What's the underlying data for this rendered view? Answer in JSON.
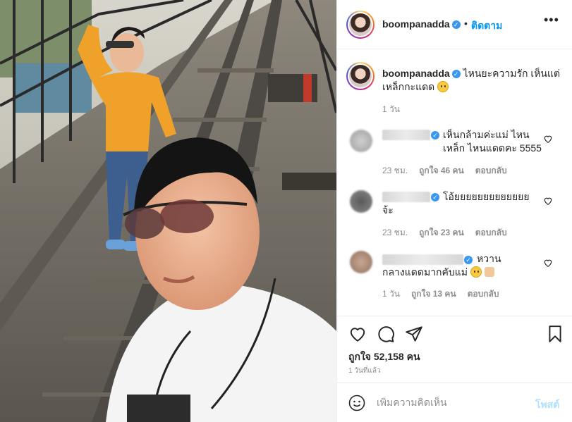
{
  "post": {
    "username": "boompanadda",
    "verified_icon": "verified-badge-icon",
    "separator": "•",
    "follow_label": "ติดตาม",
    "more_icon": "more-options-icon"
  },
  "caption": {
    "username": "boompanadda",
    "text": "ไหนยะความรัก เห็นแต่เหล็กกะแดด",
    "emoji": "slightly-frowning-face-emoji",
    "time": "1 วัน"
  },
  "comments": [
    {
      "text": "เห็นกล้ามค่ะแม่ ไหนเหล็ก ไหนแดดคะ 5555",
      "time": "23 ชม.",
      "likes": "ถูกใจ 46 คน",
      "reply": "ตอบกลับ"
    },
    {
      "text": "โอ้ยยยยยยยยยยยยยจ้ะ",
      "time": "23 ชม.",
      "likes": "ถูกใจ 23 คน",
      "reply": "ตอบกลับ"
    },
    {
      "text": "หวานกลางแดดมากคับแม่",
      "time": "1 วัน",
      "likes": "ถูกใจ 13 คน",
      "reply": "ตอบกลับ"
    }
  ],
  "actions": {
    "icons": [
      "heart-icon",
      "comment-icon",
      "share-icon",
      "bookmark-icon"
    ],
    "likes_text": "ถูกใจ 52,158 คน",
    "posted_ago": "1 วันที่แล้ว"
  },
  "comment_box": {
    "placeholder": "เพิ่มความคิดเห็น",
    "post_label": "โพสต์",
    "emoji_icon": "smiley-icon"
  },
  "colors": {
    "accent": "#0095f6",
    "verified": "#3897f0",
    "muted": "#8e8e8e",
    "post_disabled": "#b2dffc"
  }
}
